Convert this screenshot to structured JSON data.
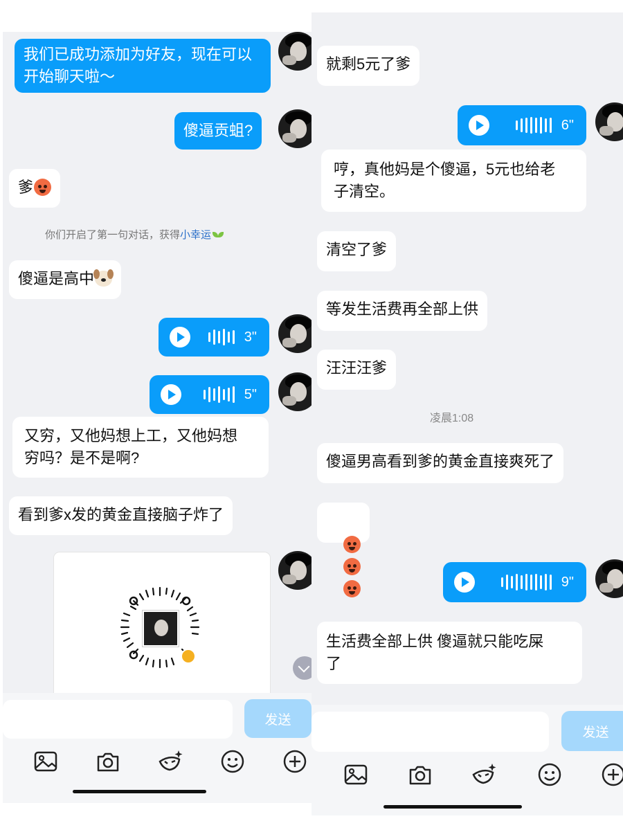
{
  "left": {
    "messages": [
      {
        "kind": "text",
        "dir": "out",
        "text": "我们已成功添加为好友，现在可以\n开始聊天啦～"
      },
      {
        "kind": "text",
        "dir": "out",
        "text": "傻逼贡蛆?"
      },
      {
        "kind": "text",
        "dir": "in",
        "text": "爹",
        "emoji": "hot-face"
      },
      {
        "kind": "system",
        "text": "你们开启了第一句对话，获得",
        "link": "小幸运"
      },
      {
        "kind": "text",
        "dir": "in",
        "text": "傻逼是高中",
        "emoji": "dog-face"
      },
      {
        "kind": "voice",
        "dir": "out",
        "duration": "3\""
      },
      {
        "kind": "voice",
        "dir": "out",
        "duration": "5\""
      },
      {
        "kind": "text",
        "dir": "in",
        "text": "又穷，又他妈想上工，又他妈想\n穷吗？是不是啊?"
      },
      {
        "kind": "text",
        "dir": "in",
        "text": "看到爹x发的黄金直接脑子炸了"
      },
      {
        "kind": "qrcode",
        "dir": "out",
        "icon": "qr-code-icon"
      }
    ],
    "send_label": "发送"
  },
  "right": {
    "messages": [
      {
        "kind": "text",
        "dir": "in",
        "text": "就剩5元了爹"
      },
      {
        "kind": "voice",
        "dir": "out",
        "duration": "6\""
      },
      {
        "kind": "text",
        "dir": "in",
        "text": "哼，真他妈是个傻逼，5元也给老\n子清空。"
      },
      {
        "kind": "text",
        "dir": "in",
        "text": "清空了爹"
      },
      {
        "kind": "text",
        "dir": "in",
        "text": "等发生活费再全部上供"
      },
      {
        "kind": "text",
        "dir": "in",
        "text": "汪汪汪爹"
      },
      {
        "kind": "time",
        "text": "凌晨1:08"
      },
      {
        "kind": "text",
        "dir": "in",
        "text": "傻逼男高看到爹的黄金直接爽死了"
      },
      {
        "kind": "emoji",
        "dir": "in",
        "emoji": "hot-face",
        "count": 3
      },
      {
        "kind": "voice",
        "dir": "out",
        "duration": "9\""
      },
      {
        "kind": "text",
        "dir": "in",
        "text": "生活费全部上供 傻逼就只能吃屎\n了"
      }
    ],
    "send_label": "发送"
  },
  "toolbar_icons": [
    "image-icon",
    "camera-icon",
    "magic-face-icon",
    "smile-icon",
    "plus-circle-icon"
  ],
  "colors": {
    "bubble_out": "#0a9dfa",
    "send_disabled": "#a5d8fc",
    "background": "#f0f1f4"
  }
}
